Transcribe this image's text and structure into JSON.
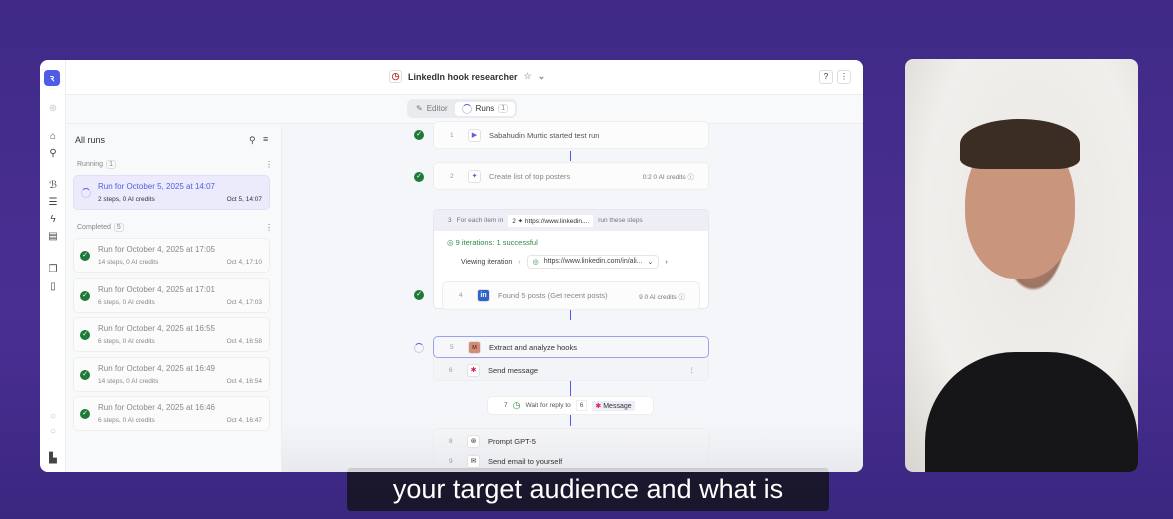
{
  "header": {
    "title": "LinkedIn hook researcher",
    "help": "?",
    "more": "⋮"
  },
  "tabs": [
    {
      "label": "Editor"
    },
    {
      "label": "Runs",
      "badge": "1"
    }
  ],
  "panel": {
    "title": "All runs",
    "running": {
      "label": "Running",
      "count": "1"
    },
    "completed": {
      "label": "Completed",
      "count": "5"
    },
    "running_runs": [
      {
        "title": "Run for October 5, 2025 at 14:07",
        "steps": "2 steps, 0 AI credits",
        "date": "Oct 5, 14:07"
      }
    ],
    "completed_runs": [
      {
        "title": "Run for October 4, 2025 at 17:05",
        "steps": "14 steps, 0 AI credits",
        "date": "Oct 4, 17:10"
      },
      {
        "title": "Run for October 4, 2025 at 17:01",
        "steps": "6 steps, 0 AI credits",
        "date": "Oct 4, 17:03"
      },
      {
        "title": "Run for October 4, 2025 at 16:55",
        "steps": "6 steps, 0 AI credits",
        "date": "Oct 4, 16:58"
      },
      {
        "title": "Run for October 4, 2025 at 16:49",
        "steps": "14 steps, 0 AI credits",
        "date": "Oct 4, 16:54"
      },
      {
        "title": "Run for October 4, 2025 at 16:46",
        "steps": "6 steps, 0 AI credits",
        "date": "Oct 4, 16:47"
      }
    ]
  },
  "steps": {
    "s1": {
      "num": "1",
      "label": "Sabahudin Murtic started test run"
    },
    "s2": {
      "num": "2",
      "label": "Create list of top posters",
      "credits": "0:2  0 AI credits"
    },
    "s3": {
      "num": "3",
      "prefix": "For each item in",
      "ref": "2",
      "url": "https://www.linkedin....",
      "suffix": "run these steps",
      "iterations": "9 iterations: 1 successful",
      "viewing": "Viewing iteration",
      "iter_url": "https://www.linkedin.com/in/ali..."
    },
    "s4": {
      "num": "4",
      "label": "Found 5 posts (Get recent posts)",
      "credits": "9  0 AI credits"
    },
    "s5": {
      "num": "5",
      "label": "Extract and analyze hooks"
    },
    "s6": {
      "num": "6",
      "label": "Send message"
    },
    "s7": {
      "num": "7",
      "label": "Wait for reply to",
      "ref": "6",
      "msg": "Message"
    },
    "s8": {
      "num": "8",
      "label": "Prompt GPT-5"
    },
    "s9": {
      "num": "9",
      "label": "Send email to yourself"
    }
  },
  "caption": "your target audience and what is"
}
